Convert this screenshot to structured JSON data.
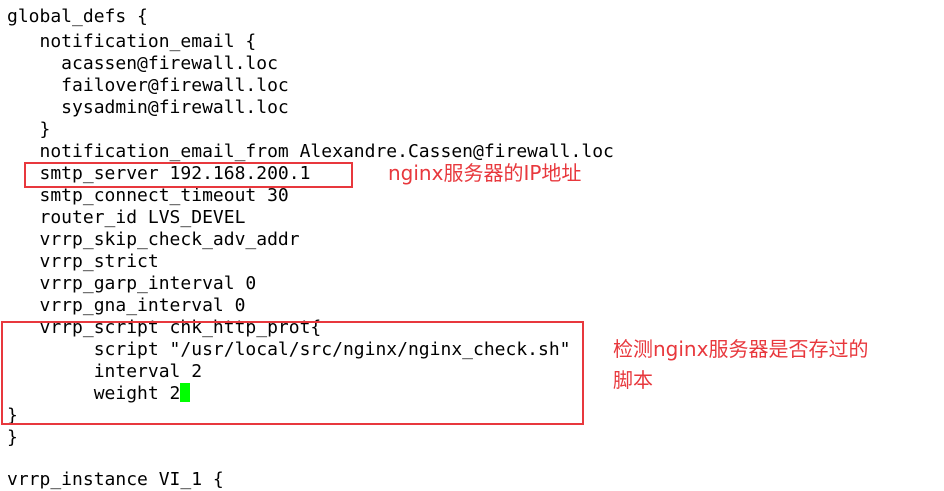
{
  "terminal": {
    "lines": [
      "global_defs {",
      "   notification_email {",
      "     acassen@firewall.loc",
      "     failover@firewall.loc",
      "     sysadmin@firewall.loc",
      "   }",
      "   notification_email_from Alexandre.Cassen@firewall.loc",
      "   smtp_server 192.168.200.1",
      "   smtp_connect_timeout 30",
      "   router_id LVS_DEVEL",
      "   vrrp_skip_check_adv_addr",
      "   vrrp_strict",
      "   vrrp_garp_interval 0",
      "   vrrp_gna_interval 0",
      "   vrrp_script chk_http_prot{",
      "        script \"/usr/local/src/nginx/nginx_check.sh\"",
      "        interval 2",
      "        weight 2",
      "}",
      "}",
      "",
      "vrrp_instance VI_1 {"
    ],
    "cursor_color": "#00ff00"
  },
  "annotations": {
    "smtp_note": "nginx服务器的IP地址",
    "script_note_line1": "检测nginx服务器是否存过的",
    "script_note_line2": "脚本",
    "color": "#e8383d"
  }
}
